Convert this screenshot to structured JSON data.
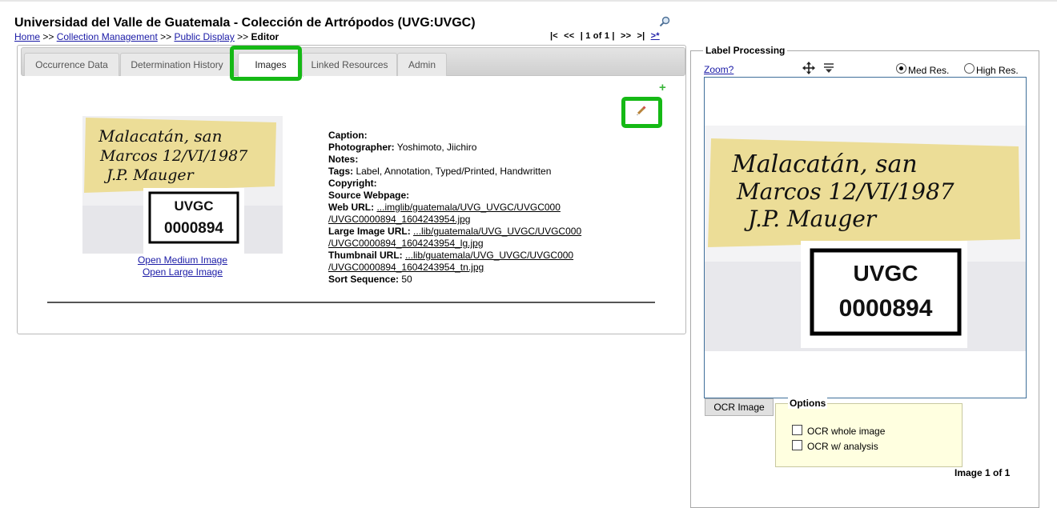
{
  "header": {
    "title": "Universidad del Valle de Guatemala - Colección de Artrópodos (UVG:UVGC)",
    "breadcrumb": {
      "home": "Home",
      "sep1": " >> ",
      "collection_mgmt": "Collection Management",
      "sep2": " >> ",
      "public_display": "Public Display",
      "sep3": " >> ",
      "current": "Editor"
    },
    "pager": {
      "first": "|<",
      "prev": "<<",
      "position": "| 1 of 1 |",
      "next": ">>",
      "last": ">|",
      "new": ">*"
    }
  },
  "tabs": [
    {
      "label": "Occurrence Data"
    },
    {
      "label": "Determination History"
    },
    {
      "label": "Images"
    },
    {
      "label": "Linked Resources"
    },
    {
      "label": "Admin"
    }
  ],
  "image_record": {
    "thumb_label_line1": "Malacatán, san",
    "thumb_label_line2": "Marcos 12/VI/1987",
    "thumb_label_line3": "J.P. Mauger",
    "catalog_code": "UVGC",
    "catalog_number": "0000894",
    "open_medium": "Open Medium Image",
    "open_large": "Open Large Image",
    "fields": {
      "caption_label": "Caption:",
      "caption_value": "",
      "photographer_label": "Photographer:",
      "photographer_value": " Yoshimoto, Jiichiro",
      "notes_label": "Notes:",
      "notes_value": "",
      "tags_label": "Tags:",
      "tags_value": " Label, Annotation, Typed/Printed, Handwritten",
      "copyright_label": "Copyright:",
      "source_label": "Source Webpage:",
      "web_url_label": "Web URL:",
      "web_url_line1": "...imglib/guatemala/UVG_UVGC/UVGC000",
      "web_url_line2": "/UVGC0000894_1604243954.jpg",
      "large_url_label": "Large Image URL:",
      "large_url_line1": "...lib/guatemala/UVG_UVGC/UVGC000",
      "large_url_line2": "/UVGC0000894_1604243954_lg.jpg",
      "thumb_url_label": "Thumbnail URL:",
      "thumb_url_line1": "...lib/guatemala/UVG_UVGC/UVGC000",
      "thumb_url_line2": "/UVGC0000894_1604243954_tn.jpg",
      "sort_label": "Sort Sequence:",
      "sort_value": " 50"
    }
  },
  "label_processing": {
    "legend": "Label Processing",
    "zoom": "Zoom?",
    "med_res": "Med Res.",
    "high_res": "High Res.",
    "selected_resolution": "Med Res.",
    "ocr_button": "OCR Image",
    "options_legend": "Options",
    "opt_whole": "OCR whole image",
    "opt_analysis": "OCR w/ analysis",
    "image_count": "Image 1 of 1"
  },
  "colors": {
    "highlight": "#15b915",
    "link": "#1a1aa6",
    "label_paper": "#efe2a0",
    "options_bg": "#ffffe0"
  }
}
